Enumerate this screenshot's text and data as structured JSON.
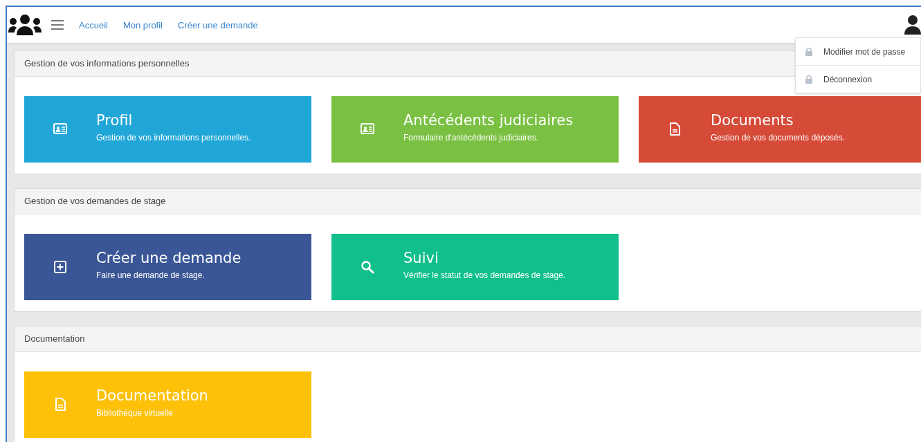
{
  "header": {
    "links": [
      {
        "label": "Accueil"
      },
      {
        "label": "Mon profil"
      },
      {
        "label": "Créer une demande"
      }
    ]
  },
  "user_menu": {
    "expanded": true,
    "items": [
      {
        "label": "Modifier mot de passe"
      },
      {
        "label": "Déconnexion"
      }
    ]
  },
  "sections": [
    {
      "title": "Gestion de vos informations personnelles",
      "tiles": [
        {
          "title": "Profil",
          "subtitle": "Gestion de vos informations personnelles.",
          "kind": "idcard",
          "color": "#21a6d8"
        },
        {
          "title": "Antécédents judiciaires",
          "subtitle": "Formulaire d'antécédents judiciaires.",
          "kind": "idcard",
          "color": "#7ac143"
        },
        {
          "title": "Documents",
          "subtitle": "Gestion de vos documents déposés.",
          "kind": "file",
          "color": "#d64a38"
        }
      ]
    },
    {
      "title": "Gestion de vos demandes de stage",
      "tiles": [
        {
          "title": "Créer une demande",
          "subtitle": "Faire une demande de stage.",
          "kind": "plus",
          "color": "#3a5696"
        },
        {
          "title": "Suivi",
          "subtitle": "Vérifier le statut de vos demandes de stage.",
          "kind": "search",
          "color": "#10bf8c"
        }
      ]
    },
    {
      "title": "Documentation",
      "tiles": [
        {
          "title": "Documentation",
          "subtitle": "Bibliothèque virtuelle",
          "kind": "file",
          "color": "#fdc10a"
        }
      ]
    }
  ]
}
